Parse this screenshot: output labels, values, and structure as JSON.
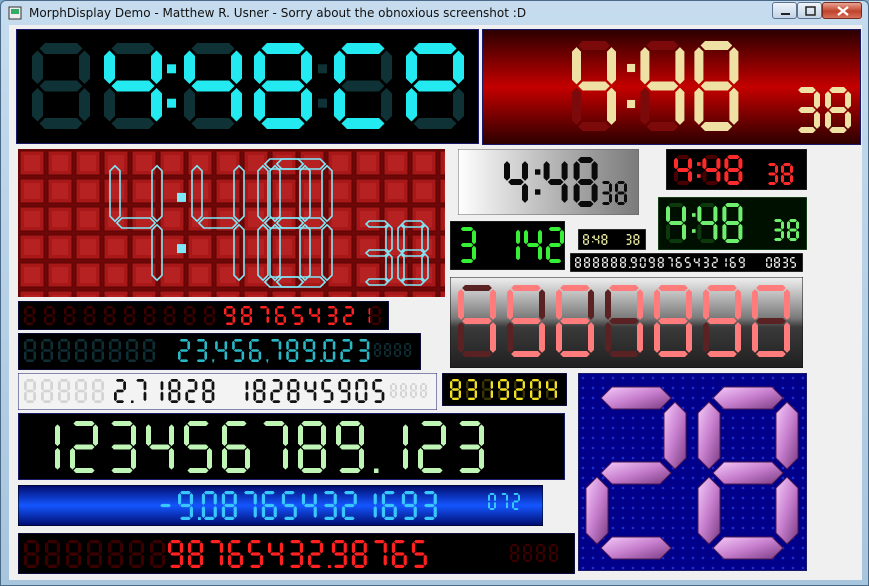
{
  "window": {
    "title": "MorphDisplay Demo - Matthew R. Usner - Sorry about the obnoxious screenshot :D",
    "controls": {
      "minimize": "minimize-icon",
      "maximize": "maximize-icon",
      "close": "close-icon"
    }
  },
  "displays": [
    {
      "id": "d01",
      "text": "88:88  ",
      "lit": "44:48CP",
      "on": "#22eaf0",
      "off": "#0e3236",
      "bg": "#000000",
      "border": "#1a1a6a"
    },
    {
      "id": "d02",
      "time": "4:48",
      "seconds": "38",
      "on": "#efe0a4",
      "off": "#7c0a0a",
      "bg": "red-gradient"
    },
    {
      "id": "d03",
      "time": "4:48",
      "seconds": "38",
      "on": "#7fe8f8",
      "style": "outline",
      "bg": "red-brick"
    },
    {
      "id": "d04",
      "time": "4:48",
      "seconds": "38",
      "on": "#0a0a0a",
      "off": "#9a9a9a",
      "bg": "silver-gradient"
    },
    {
      "id": "d05",
      "ghost": "8:88",
      "time": "4:48",
      "seconds": "38",
      "on": "#ff2a2a",
      "off": "#4a0000",
      "bg": "#000000"
    },
    {
      "id": "d06",
      "ghost": "8:88",
      "time": "4:48",
      "seconds": "38",
      "on": "#6ef06e",
      "off": "#0c3a0c",
      "bg": "#001000"
    },
    {
      "id": "d07",
      "text": "3 142",
      "on": "#36f036",
      "off": "#0a300a",
      "bg": "#000000"
    },
    {
      "id": "d08",
      "text": "8:48  38",
      "on": "#e6e6a0",
      "bg": "#000000"
    },
    {
      "id": "d09",
      "text": "888888.9098765432169",
      "extra": "0835",
      "on": "#e6e6e6",
      "off": "#3a3a3a",
      "bg": "#000000"
    },
    {
      "id": "d10",
      "text": "4567890",
      "on": "#ff7c7c",
      "off": "#5a2222",
      "bg": "gray-gradient"
    },
    {
      "id": "d11",
      "ghost": "8888888888",
      "text": "987654321",
      "on": "#ff2020",
      "off": "#3c0000",
      "bg": "#000000"
    },
    {
      "id": "d12",
      "ghost": "88888888",
      "text": "23,456,789.023",
      "extra": "8888",
      "on": "#29b8c6",
      "off": "#0e2e34",
      "bg": "#000000"
    },
    {
      "id": "d13",
      "ghost": "88888",
      "text": "2.71828 182845905",
      "extra": "8888",
      "on": "#111111",
      "off": "#d4d4d4",
      "bg": "#f3f3f3"
    },
    {
      "id": "d14",
      "text": "8319204",
      "on": "#f0e020",
      "off": "#3a3400",
      "bg": "#000000"
    },
    {
      "id": "d15",
      "text": "123456789.123",
      "on": "#bff6b6",
      "off": "#1b2a1b",
      "bg": "#000000"
    },
    {
      "id": "d16",
      "text": "-9.087654321693",
      "extra": "072",
      "on": "#38c8ff",
      "off": "#001a6a",
      "bg": "blue-gradient"
    },
    {
      "id": "d17",
      "ghost": "8888888",
      "text": "98765432.98765",
      "extra": "8888",
      "on": "#ff2020",
      "off": "#3a0000",
      "bg": "#000000"
    },
    {
      "id": "d18",
      "text": "28",
      "on": "#e49ae8",
      "bg": "#000080"
    }
  ],
  "colors": {
    "client": "#f0f0f0",
    "frame": "#a8c5de"
  }
}
